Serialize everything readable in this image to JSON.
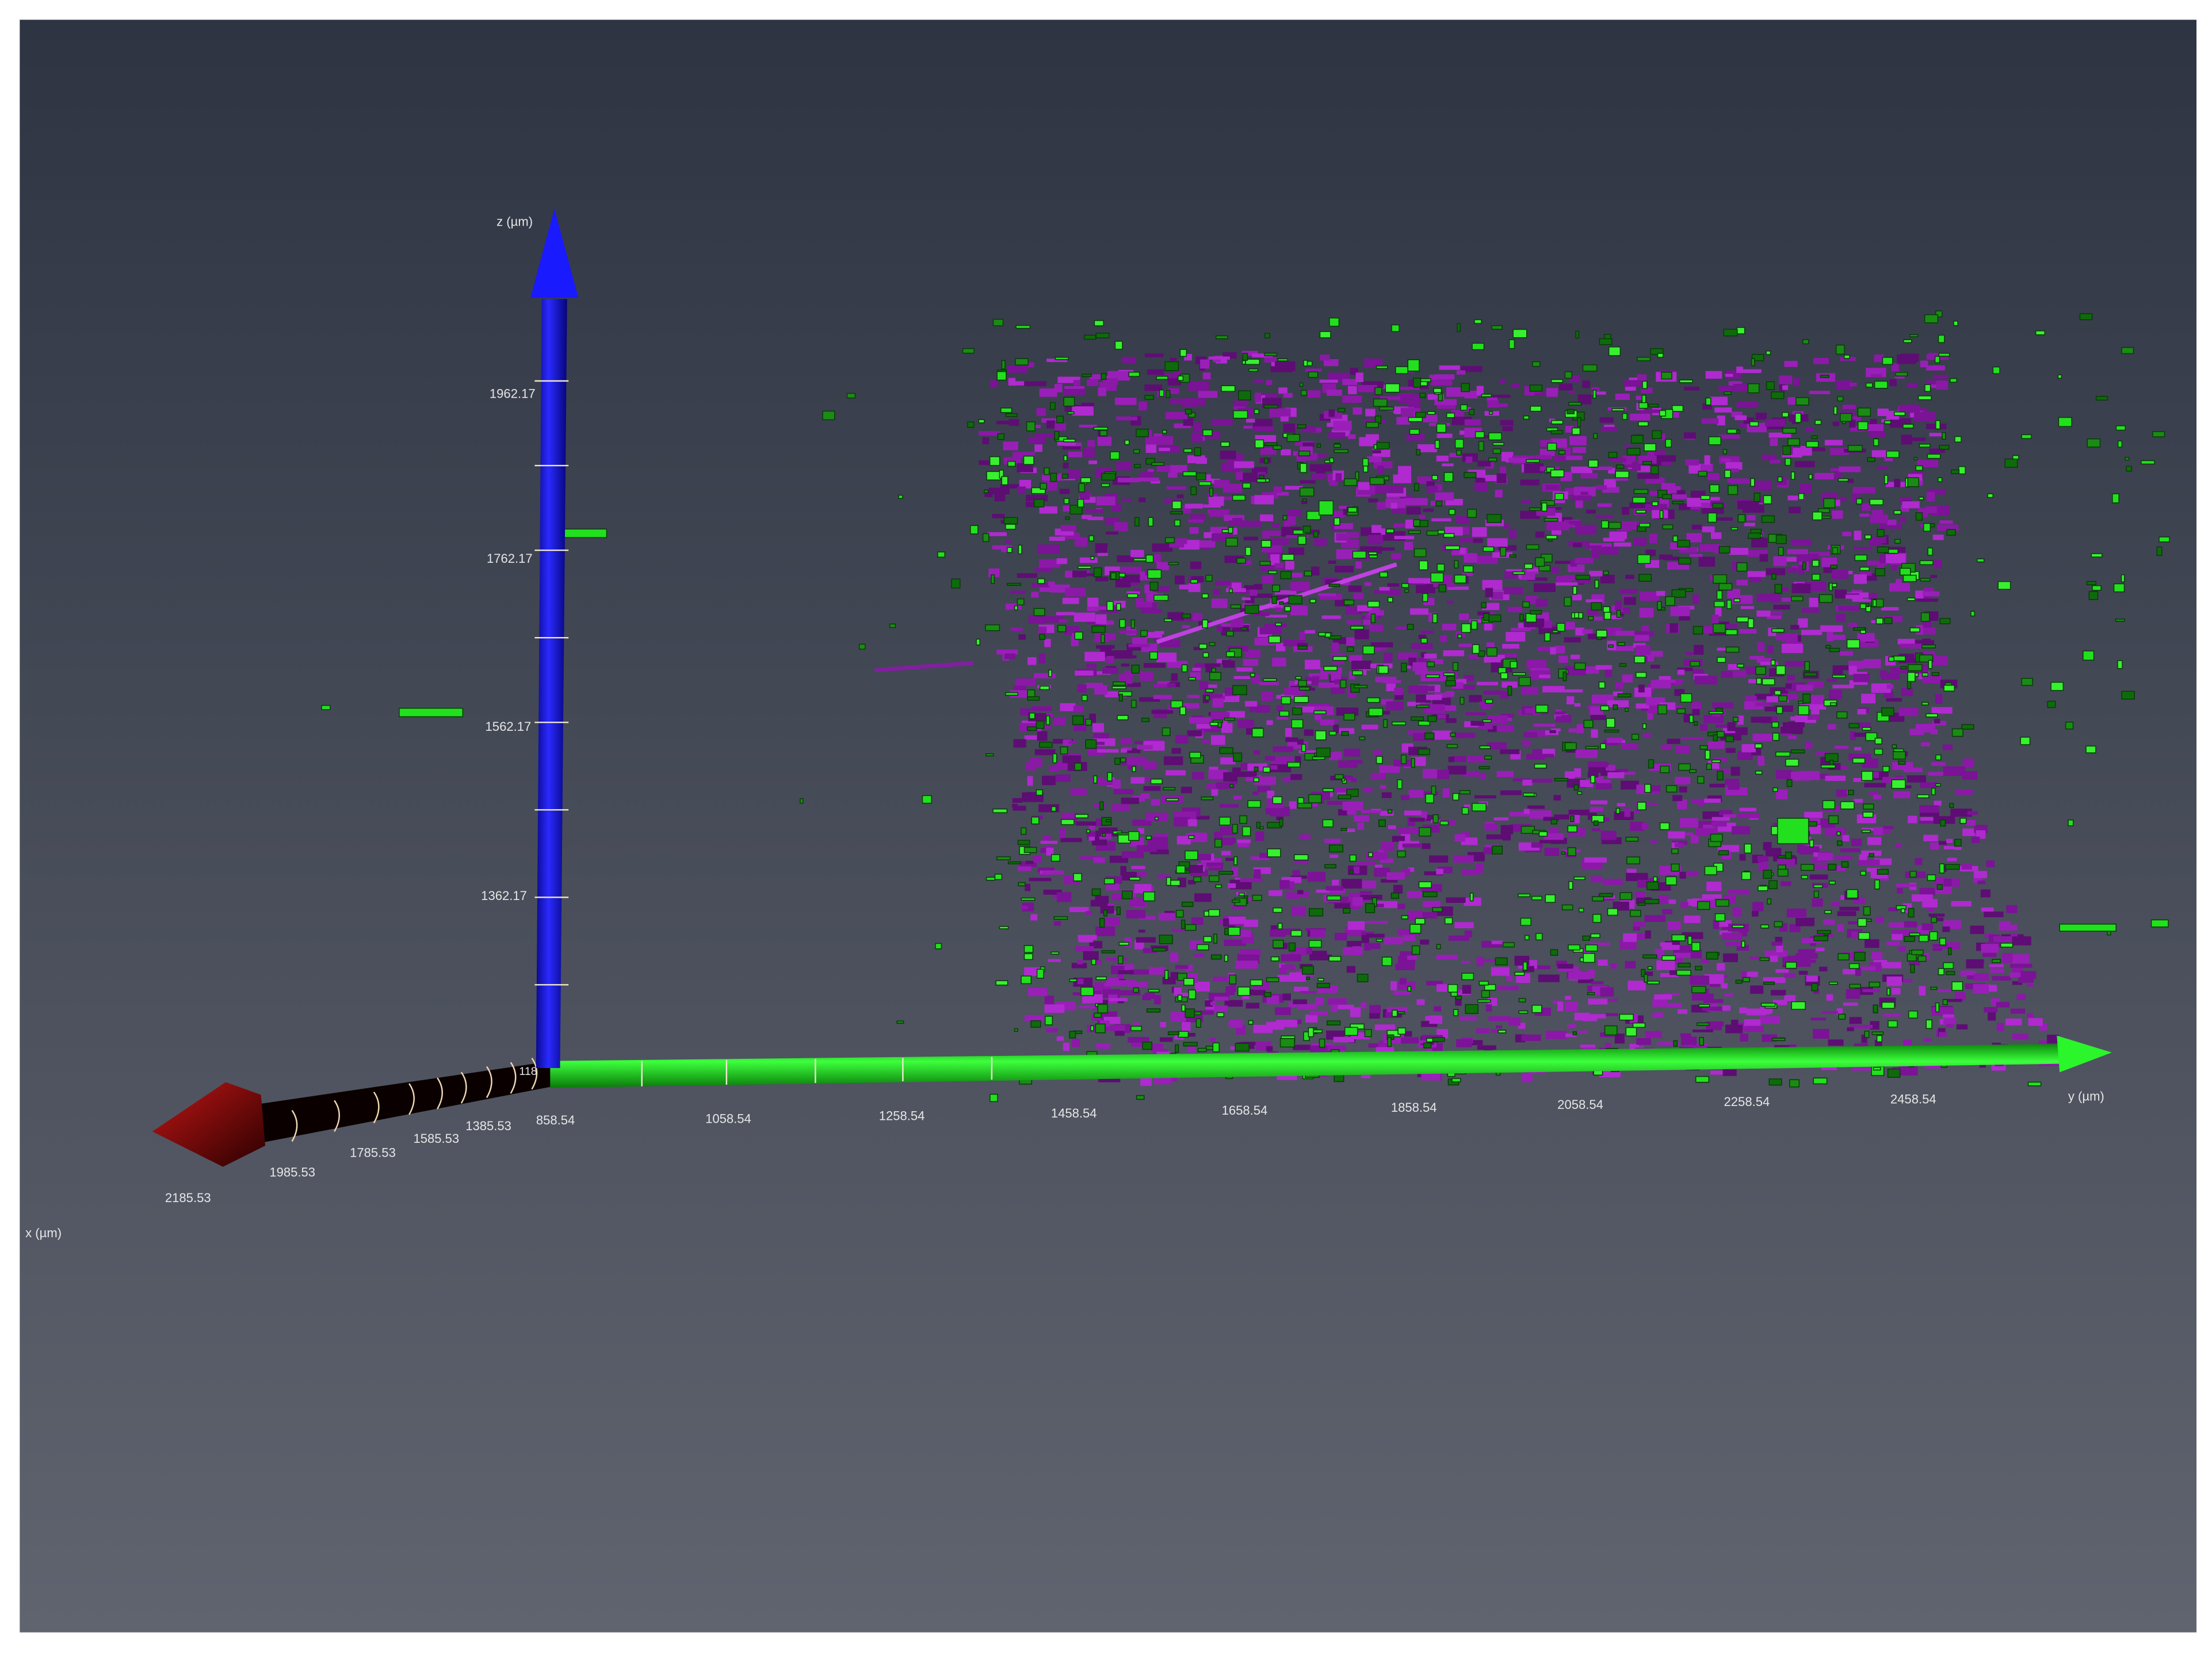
{
  "viewer": {
    "background_top": "#2e3442",
    "background_bottom": "#60646f",
    "channel_colors": {
      "purple": "#9a1fb8",
      "green": "#22e01e"
    }
  },
  "axes": {
    "x": {
      "label": "x (µm)",
      "color": "#7a0c0c",
      "ticks": [
        "1385.53",
        "1585.53",
        "1785.53",
        "1985.53",
        "2185.53"
      ],
      "partial_label": "118"
    },
    "y": {
      "label": "y (µm)",
      "color": "#2bf52b",
      "ticks": [
        "858.54",
        "1058.54",
        "1258.54",
        "1458.54",
        "1658.54",
        "1858.54",
        "2058.54",
        "2258.54",
        "2458.54"
      ]
    },
    "z": {
      "label": "z (µm)",
      "color": "#1010e8",
      "ticks": [
        "1962.17",
        "1762.17",
        "1562.17",
        "1362.17"
      ]
    }
  }
}
